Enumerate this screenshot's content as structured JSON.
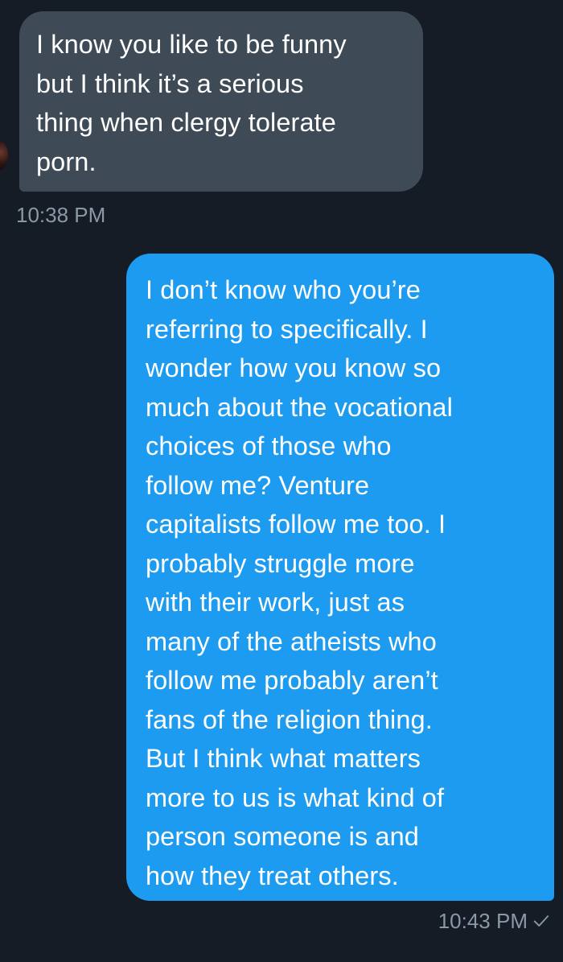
{
  "conversation": {
    "messages": [
      {
        "direction": "incoming",
        "text": "I know you like to be funny\nbut I think it’s a serious\nthing when clergy tolerate\nporn.",
        "time": "10:38 PM"
      },
      {
        "direction": "outgoing",
        "text": "I don’t know who you’re\nreferring to specifically. I\nwonder how you know so\nmuch about the vocational\nchoices of those who\nfollow me? Venture\ncapitalists follow me too. I\nprobably struggle more\nwith their work, just as\nmany of the atheists who\nfollow me probably aren’t\nfans of the religion thing.\nBut I think what matters\nmore to us is what kind of\nperson someone is and\nhow they treat others.",
        "time": "10:43 PM",
        "status_icon": "checkmark-icon"
      }
    ]
  },
  "colors": {
    "background": "#151c26",
    "incoming_bubble": "#3e4a56",
    "outgoing_bubble": "#1d9bf0",
    "timestamp": "#8b98a5",
    "text": "#ffffff"
  }
}
